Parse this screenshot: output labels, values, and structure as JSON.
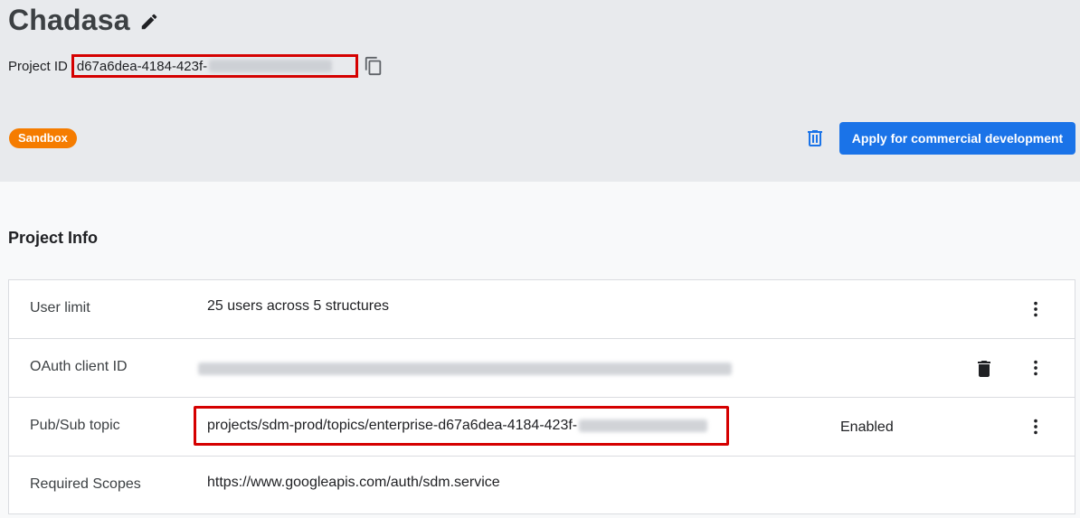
{
  "project": {
    "name": "Chadasa",
    "id_label": "Project ID",
    "id_visible": "d67a6dea-4184-423f-",
    "environment_badge": "Sandbox"
  },
  "actions": {
    "apply_label": "Apply for commercial development"
  },
  "icons": {
    "edit": "edit-pencil-icon",
    "copy": "copy-icon",
    "delete": "trash-icon",
    "more": "more-vert-icon"
  },
  "section": {
    "title": "Project Info"
  },
  "info_rows": [
    {
      "label": "User limit",
      "value": "25 users across 5 structures"
    },
    {
      "label": "OAuth client ID",
      "value": ""
    },
    {
      "label": "Pub/Sub topic",
      "value": "projects/sdm-prod/topics/enterprise-d67a6dea-4184-423f-",
      "status": "Enabled"
    },
    {
      "label": "Required Scopes",
      "value": "https://www.googleapis.com/auth/sdm.service"
    }
  ],
  "colors": {
    "header_bg": "#e8eaed",
    "badge": "#f57c00",
    "primary": "#1a73e8",
    "highlight": "#d50000"
  }
}
